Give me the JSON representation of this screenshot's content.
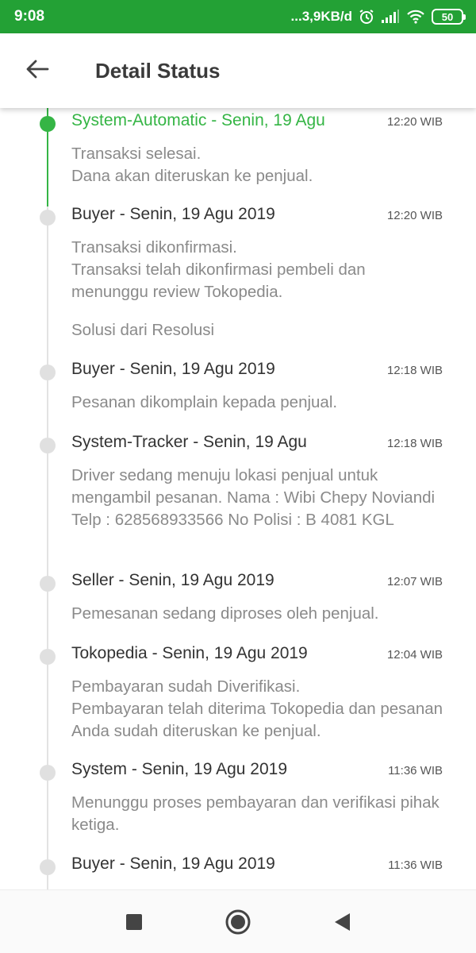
{
  "status_bar": {
    "time": "9:08",
    "network_speed": "...3,9KB/d",
    "battery": "50",
    "icons": [
      "alarm-icon",
      "signal-icon",
      "wifi-icon",
      "battery-icon"
    ]
  },
  "header": {
    "title": "Detail Status",
    "back_icon": "arrow-left-icon"
  },
  "colors": {
    "status_bar": "#23a135",
    "accent": "#35b545",
    "dot_inactive": "#e0e0e0"
  },
  "timeline": [
    {
      "title": "System-Automatic - Senin, 19 Agu",
      "time": "12:20 WIB",
      "lines": [
        "Transaksi selesai.",
        "Dana akan diteruskan ke penjual."
      ],
      "active": true
    },
    {
      "title": "Buyer - Senin, 19 Agu 2019",
      "time": "12:20 WIB",
      "lines": [
        "Transaksi dikonfirmasi.",
        "Transaksi telah dikonfirmasi pembeli dan menunggu review Tokopedia."
      ],
      "extra": "Solusi dari Resolusi"
    },
    {
      "title": "Buyer - Senin, 19 Agu 2019",
      "time": "12:18 WIB",
      "lines": [
        "Pesanan dikomplain kepada penjual."
      ]
    },
    {
      "title": "System-Tracker - Senin, 19 Agu",
      "time": "12:18 WIB",
      "lines": [
        "Driver sedang menuju lokasi penjual untuk mengambil pesanan. Nama : Wibi Chepy Noviandi Telp : 628568933566 No Polisi : B 4081 KGL"
      ]
    },
    {
      "title": "Seller - Senin, 19 Agu 2019",
      "time": "12:07 WIB",
      "lines": [
        "Pemesanan sedang diproses oleh penjual."
      ]
    },
    {
      "title": "Tokopedia - Senin, 19 Agu 2019",
      "time": "12:04 WIB",
      "lines": [
        "Pembayaran sudah Diverifikasi.",
        "Pembayaran telah diterima Tokopedia dan pesanan Anda sudah diteruskan ke penjual."
      ]
    },
    {
      "title": "System - Senin, 19 Agu 2019",
      "time": "11:36 WIB",
      "lines": [
        "Menunggu proses pembayaran dan verifikasi pihak ketiga."
      ]
    },
    {
      "title": "Buyer - Senin, 19 Agu 2019",
      "time": "11:36 WIB",
      "lines": []
    }
  ],
  "nav_bar": {
    "icons": [
      "recent-apps-icon",
      "home-icon",
      "back-triangle-icon"
    ]
  }
}
